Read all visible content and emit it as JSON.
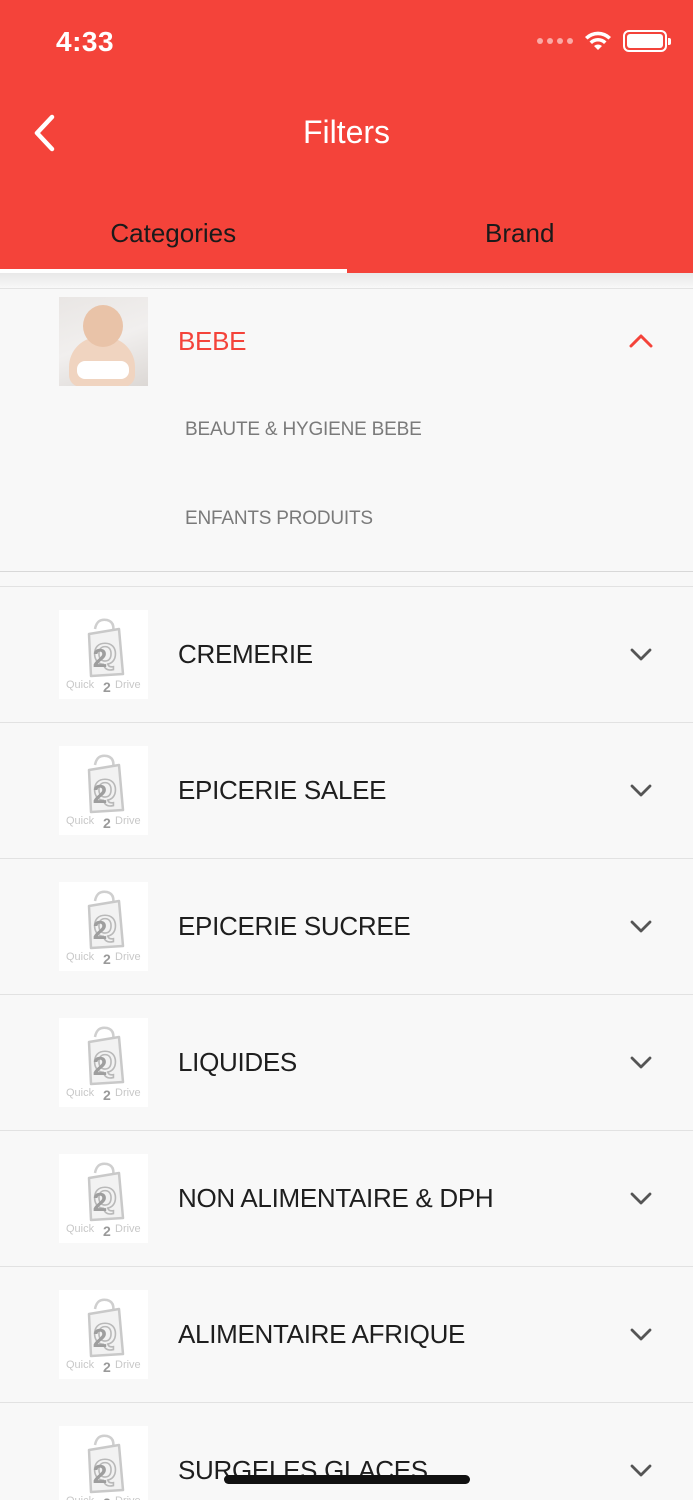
{
  "status": {
    "time": "4:33"
  },
  "header": {
    "title": "Filters",
    "back_icon": "chevron-left-icon"
  },
  "tabs": [
    {
      "label": "Categories",
      "active": true
    },
    {
      "label": "Brand",
      "active": false
    }
  ],
  "colors": {
    "accent": "#f4433a",
    "text": "#1e1e1e",
    "sub_text": "#7a7a7a",
    "background": "#f8f8f8"
  },
  "expanded_category": {
    "label": "BEBE",
    "image": "baby-photo",
    "subcategories": [
      "BEAUTE & HYGIENE BEBE",
      "ENFANTS PRODUITS"
    ]
  },
  "categories": [
    {
      "label": "CREMERIE"
    },
    {
      "label": "EPICERIE SALEE"
    },
    {
      "label": "EPICERIE SUCREE"
    },
    {
      "label": "LIQUIDES"
    },
    {
      "label": "NON ALIMENTAIRE  & DPH"
    },
    {
      "label": "ALIMENTAIRE AFRIQUE"
    },
    {
      "label": "SURGELES GLACES"
    }
  ],
  "placeholder_logo": {
    "line1": "Quick",
    "line2": "2",
    "line3": "Drive"
  }
}
